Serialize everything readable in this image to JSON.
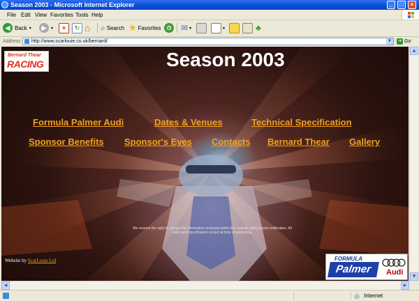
{
  "window": {
    "title": "Season 2003 - Microsoft Internet Explorer",
    "controls": {
      "minimize": "_",
      "maximize": "□",
      "close": "×"
    }
  },
  "menubar": {
    "items": [
      "File",
      "Edit",
      "View",
      "Favorites",
      "Tools",
      "Help"
    ]
  },
  "toolbar": {
    "back_label": "Back",
    "search_label": "Search",
    "favorites_label": "Favorites"
  },
  "address": {
    "label": "Address",
    "url": "http://www.scarlouie.co.uk/bernard/",
    "go_label": "Go"
  },
  "page": {
    "heading": "Season 2003",
    "logo": {
      "line1": "Bernard Thear",
      "line2": "RACING"
    },
    "nav_row1": [
      "Formula Palmer Audi",
      "Dates & Venues",
      "Technical Specification"
    ],
    "nav_row2": [
      "Sponsor Benefits",
      "Sponsor's Eyes",
      "Contacts",
      "Bernard Thear",
      "Gallery"
    ],
    "disclaimer": "We reserve the right to change the information enclosed within this website without prior notification. All dates and specification correct at time of publishing.",
    "credit_prefix": "Website by",
    "credit_link": "ScarLouie Ltd",
    "sponsor": {
      "formula": "FORMULA",
      "palmer": "Palmer",
      "audi": "Audi"
    }
  },
  "statusbar": {
    "zone": "Internet"
  },
  "colors": {
    "link": "#f0a020",
    "heading": "#ffffff",
    "titlebar": "#0a4ed8"
  }
}
